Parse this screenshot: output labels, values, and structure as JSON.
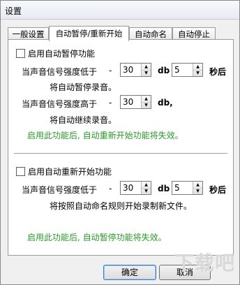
{
  "window": {
    "title": "设置"
  },
  "tabs": [
    {
      "label": "一般设置",
      "active": false
    },
    {
      "label": "自动暂停/重新开始",
      "active": true
    },
    {
      "label": "自动命名",
      "active": false
    },
    {
      "label": "自动停止",
      "active": false
    }
  ],
  "auto_pause": {
    "checkbox_label": "启用自动暂停功能",
    "checked": false,
    "line1_prefix": "当声音信号强度低于",
    "line1_value": "30",
    "line1_unit": "db",
    "line1_seconds": "5",
    "line1_suffix": "秒后",
    "line1_result": "将自动暂停录音。",
    "line2_prefix": "当声音信号强度高于",
    "line2_value": "30",
    "line2_unit": "db,",
    "line2_result": "将自动继续录音。",
    "note": "启用此功能后, 自动重新开始功能将失效。"
  },
  "auto_restart": {
    "checkbox_label": "启用自动重新开始功能",
    "checked": false,
    "line1_prefix": "当声音信号强度低于",
    "line1_value": "30",
    "line1_unit": "db",
    "line1_seconds": "5",
    "line1_suffix": "秒后",
    "line1_result": "将按照自动命名规则开始录制新文件。",
    "note": "启用此功能后, 自动暂停功能将失效。"
  },
  "buttons": {
    "ok": "确定",
    "cancel": "取消"
  },
  "watermark": "下载吧",
  "colors": {
    "note_text": "#2a9a2a"
  }
}
